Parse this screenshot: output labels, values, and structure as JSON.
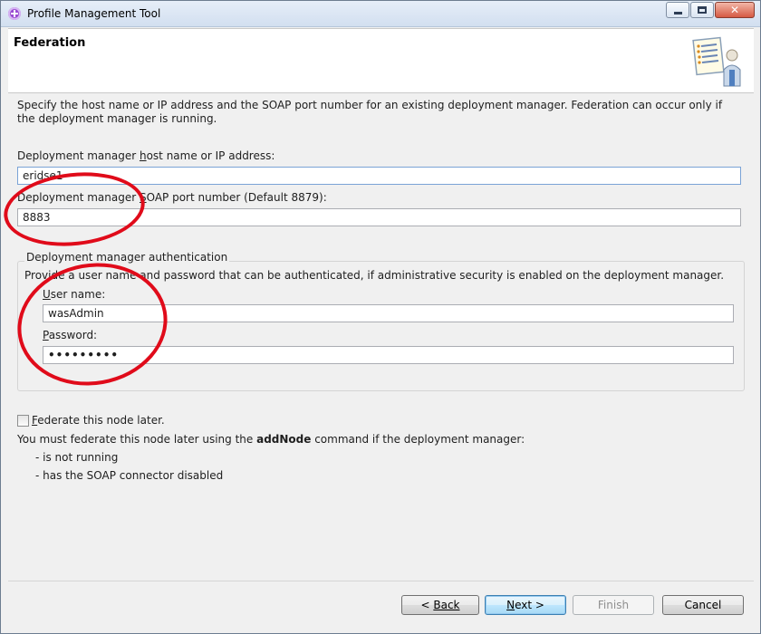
{
  "window": {
    "title": "Profile Management Tool"
  },
  "header": {
    "title": "Federation"
  },
  "description": "Specify the host name or IP address and the SOAP port number for an existing deployment manager. Federation can occur only if the deployment manager is running.",
  "host": {
    "label_pre": "Deployment manager ",
    "label_key": "h",
    "label_post": "ost name or IP address:",
    "value": "eridse1"
  },
  "port": {
    "label_pre": "Deployment manager ",
    "label_key": "S",
    "label_post": "OAP port number (Default 8879):",
    "value": "8883"
  },
  "auth": {
    "legend": "Deployment manager authentication",
    "description": "Provide a user name and password that can be authenticated, if administrative security is enabled on the deployment manager.",
    "user_label_key": "U",
    "user_label_post": "ser name:",
    "user_value": "wasAdmin",
    "password_label_key": "P",
    "password_label_post": "assword:",
    "password_value": "•••••••••"
  },
  "federate_later": {
    "label_key": "F",
    "label_post": "ederate this node later.",
    "checked": false,
    "note_pre": "You must federate this node later using the ",
    "note_cmd": "addNode",
    "note_post": " command if the deployment manager:",
    "bullets": [
      "- is not running",
      "- has the SOAP connector disabled"
    ]
  },
  "buttons": {
    "back": "Back",
    "back_prefix": "< ",
    "next": "Next >",
    "next_key": "N",
    "next_post": "ext >",
    "finish": "Finish",
    "cancel": "Cancel"
  },
  "colors": {
    "annotation": "#e00b1a",
    "accent": "#3c7fb1"
  },
  "icons": {
    "app": "profile-tool-icon",
    "header": "profile-wizard-icon"
  }
}
